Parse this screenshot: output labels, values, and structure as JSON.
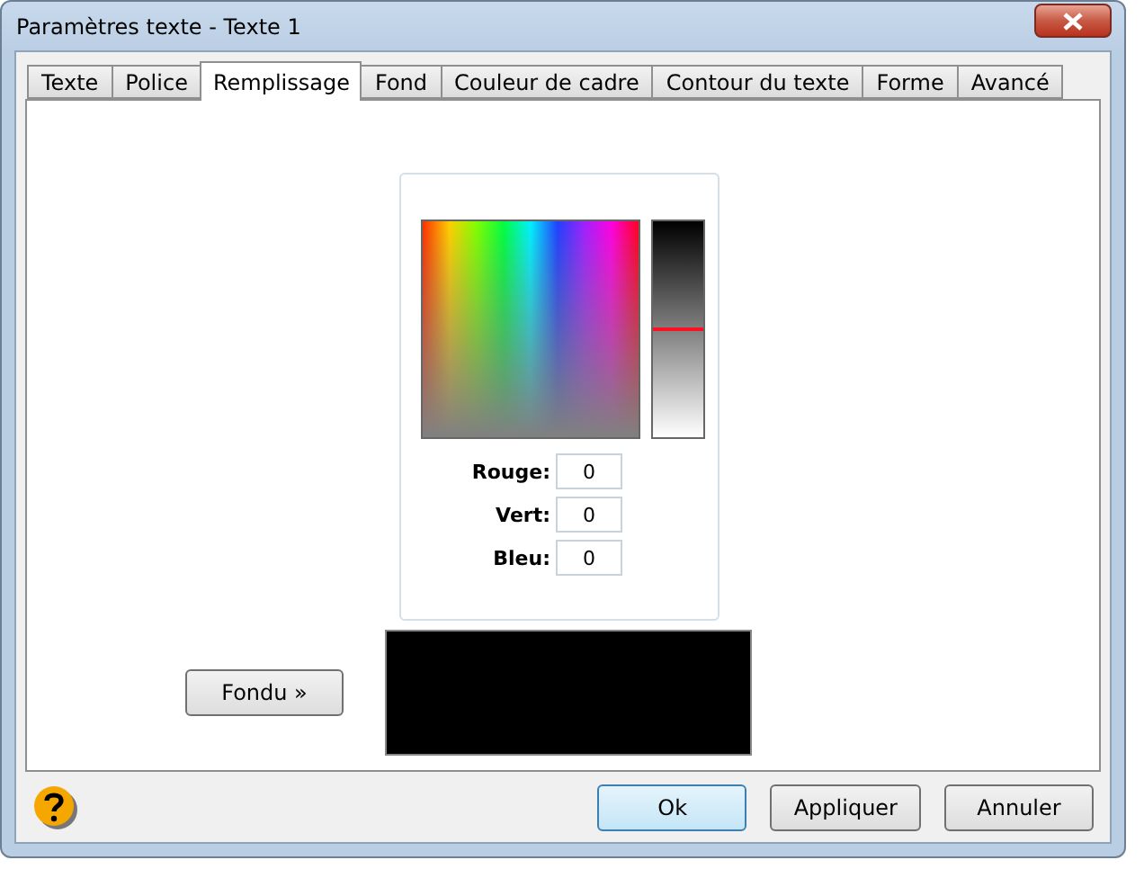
{
  "window": {
    "title": "Paramètres texte - Texte 1"
  },
  "tabs": [
    {
      "label": "Texte",
      "selected": false
    },
    {
      "label": "Police",
      "selected": false
    },
    {
      "label": "Remplissage",
      "selected": true
    },
    {
      "label": "Fond",
      "selected": false
    },
    {
      "label": "Couleur de cadre",
      "selected": false
    },
    {
      "label": "Contour du texte",
      "selected": false
    },
    {
      "label": "Forme",
      "selected": false
    },
    {
      "label": "Avancé",
      "selected": false
    }
  ],
  "color_picker": {
    "lightness": {
      "level": 0.49
    },
    "fields": [
      {
        "label": "Rouge:",
        "value": "0"
      },
      {
        "label": "Vert:",
        "value": "0"
      },
      {
        "label": "Bleu:",
        "value": "0"
      }
    ]
  },
  "gradient_button": "Fondu »",
  "buttons": [
    {
      "label": "Ok",
      "default": true
    },
    {
      "label": "Appliquer",
      "default": false
    },
    {
      "label": "Annuler",
      "default": false
    }
  ]
}
